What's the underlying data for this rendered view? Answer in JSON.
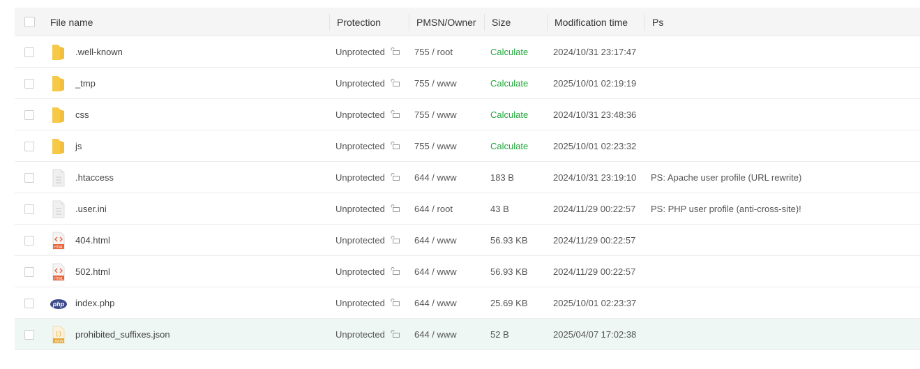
{
  "header": {
    "file_name": "File name",
    "protection": "Protection",
    "permission_owner": "PMSN/Owner",
    "size": "Size",
    "modification_time": "Modification time",
    "ps": "Ps"
  },
  "colors": {
    "accent_green": "#20a53a",
    "folder": "#f7c948",
    "html": "#e8653a",
    "php": "#3d4a8a",
    "json": "#e3a93a"
  },
  "rows": [
    {
      "name": ".well-known",
      "icon": "folder-icon",
      "protection": "Unprotected",
      "perm": "755 / root",
      "size": "Calculate",
      "mtime": "2024/10/31 23:17:47",
      "ps": ""
    },
    {
      "name": "_tmp",
      "icon": "folder-icon",
      "protection": "Unprotected",
      "perm": "755 / www",
      "size": "Calculate",
      "mtime": "2025/10/01 02:19:19",
      "ps": ""
    },
    {
      "name": "css",
      "icon": "folder-icon",
      "protection": "Unprotected",
      "perm": "755 / www",
      "size": "Calculate",
      "mtime": "2024/10/31 23:48:36",
      "ps": ""
    },
    {
      "name": "js",
      "icon": "folder-icon",
      "protection": "Unprotected",
      "perm": "755 / www",
      "size": "Calculate",
      "mtime": "2025/10/01 02:23:32",
      "ps": ""
    },
    {
      "name": ".htaccess",
      "icon": "text-file-icon",
      "protection": "Unprotected",
      "perm": "644 / www",
      "size": "183 B",
      "mtime": "2024/10/31 23:19:10",
      "ps": "PS: Apache user profile (URL rewrite)"
    },
    {
      "name": ".user.ini",
      "icon": "text-file-icon",
      "protection": "Unprotected",
      "perm": "644 / root",
      "size": "43 B",
      "mtime": "2024/11/29 00:22:57",
      "ps": "PS: PHP user profile (anti-cross-site)!"
    },
    {
      "name": "404.html",
      "icon": "html-file-icon",
      "icon_text": "HTML",
      "protection": "Unprotected",
      "perm": "644 / www",
      "size": "56.93 KB",
      "mtime": "2024/11/29 00:22:57",
      "ps": ""
    },
    {
      "name": "502.html",
      "icon": "html-file-icon",
      "icon_text": "HTML",
      "protection": "Unprotected",
      "perm": "644 / www",
      "size": "56.93 KB",
      "mtime": "2024/11/29 00:22:57",
      "ps": ""
    },
    {
      "name": "index.php",
      "icon": "php-file-icon",
      "icon_text": "php",
      "protection": "Unprotected",
      "perm": "644 / www",
      "size": "25.69 KB",
      "mtime": "2025/10/01 02:23:37",
      "ps": ""
    },
    {
      "name": "prohibited_suffixes.json",
      "icon": "json-file-icon",
      "icon_text": "JSON",
      "protection": "Unprotected",
      "perm": "644 / www",
      "size": "52 B",
      "mtime": "2025/04/07 17:02:38",
      "ps": ""
    }
  ]
}
